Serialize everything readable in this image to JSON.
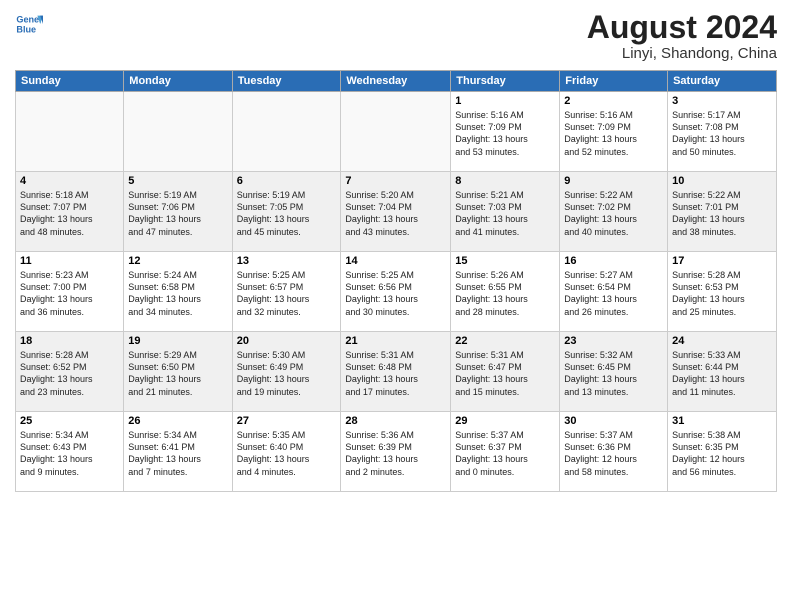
{
  "header": {
    "logo_line1": "General",
    "logo_line2": "Blue",
    "month_title": "August 2024",
    "location": "Linyi, Shandong, China"
  },
  "weekdays": [
    "Sunday",
    "Monday",
    "Tuesday",
    "Wednesday",
    "Thursday",
    "Friday",
    "Saturday"
  ],
  "weeks": [
    [
      {
        "day": "",
        "info": ""
      },
      {
        "day": "",
        "info": ""
      },
      {
        "day": "",
        "info": ""
      },
      {
        "day": "",
        "info": ""
      },
      {
        "day": "1",
        "info": "Sunrise: 5:16 AM\nSunset: 7:09 PM\nDaylight: 13 hours\nand 53 minutes."
      },
      {
        "day": "2",
        "info": "Sunrise: 5:16 AM\nSunset: 7:09 PM\nDaylight: 13 hours\nand 52 minutes."
      },
      {
        "day": "3",
        "info": "Sunrise: 5:17 AM\nSunset: 7:08 PM\nDaylight: 13 hours\nand 50 minutes."
      }
    ],
    [
      {
        "day": "4",
        "info": "Sunrise: 5:18 AM\nSunset: 7:07 PM\nDaylight: 13 hours\nand 48 minutes."
      },
      {
        "day": "5",
        "info": "Sunrise: 5:19 AM\nSunset: 7:06 PM\nDaylight: 13 hours\nand 47 minutes."
      },
      {
        "day": "6",
        "info": "Sunrise: 5:19 AM\nSunset: 7:05 PM\nDaylight: 13 hours\nand 45 minutes."
      },
      {
        "day": "7",
        "info": "Sunrise: 5:20 AM\nSunset: 7:04 PM\nDaylight: 13 hours\nand 43 minutes."
      },
      {
        "day": "8",
        "info": "Sunrise: 5:21 AM\nSunset: 7:03 PM\nDaylight: 13 hours\nand 41 minutes."
      },
      {
        "day": "9",
        "info": "Sunrise: 5:22 AM\nSunset: 7:02 PM\nDaylight: 13 hours\nand 40 minutes."
      },
      {
        "day": "10",
        "info": "Sunrise: 5:22 AM\nSunset: 7:01 PM\nDaylight: 13 hours\nand 38 minutes."
      }
    ],
    [
      {
        "day": "11",
        "info": "Sunrise: 5:23 AM\nSunset: 7:00 PM\nDaylight: 13 hours\nand 36 minutes."
      },
      {
        "day": "12",
        "info": "Sunrise: 5:24 AM\nSunset: 6:58 PM\nDaylight: 13 hours\nand 34 minutes."
      },
      {
        "day": "13",
        "info": "Sunrise: 5:25 AM\nSunset: 6:57 PM\nDaylight: 13 hours\nand 32 minutes."
      },
      {
        "day": "14",
        "info": "Sunrise: 5:25 AM\nSunset: 6:56 PM\nDaylight: 13 hours\nand 30 minutes."
      },
      {
        "day": "15",
        "info": "Sunrise: 5:26 AM\nSunset: 6:55 PM\nDaylight: 13 hours\nand 28 minutes."
      },
      {
        "day": "16",
        "info": "Sunrise: 5:27 AM\nSunset: 6:54 PM\nDaylight: 13 hours\nand 26 minutes."
      },
      {
        "day": "17",
        "info": "Sunrise: 5:28 AM\nSunset: 6:53 PM\nDaylight: 13 hours\nand 25 minutes."
      }
    ],
    [
      {
        "day": "18",
        "info": "Sunrise: 5:28 AM\nSunset: 6:52 PM\nDaylight: 13 hours\nand 23 minutes."
      },
      {
        "day": "19",
        "info": "Sunrise: 5:29 AM\nSunset: 6:50 PM\nDaylight: 13 hours\nand 21 minutes."
      },
      {
        "day": "20",
        "info": "Sunrise: 5:30 AM\nSunset: 6:49 PM\nDaylight: 13 hours\nand 19 minutes."
      },
      {
        "day": "21",
        "info": "Sunrise: 5:31 AM\nSunset: 6:48 PM\nDaylight: 13 hours\nand 17 minutes."
      },
      {
        "day": "22",
        "info": "Sunrise: 5:31 AM\nSunset: 6:47 PM\nDaylight: 13 hours\nand 15 minutes."
      },
      {
        "day": "23",
        "info": "Sunrise: 5:32 AM\nSunset: 6:45 PM\nDaylight: 13 hours\nand 13 minutes."
      },
      {
        "day": "24",
        "info": "Sunrise: 5:33 AM\nSunset: 6:44 PM\nDaylight: 13 hours\nand 11 minutes."
      }
    ],
    [
      {
        "day": "25",
        "info": "Sunrise: 5:34 AM\nSunset: 6:43 PM\nDaylight: 13 hours\nand 9 minutes."
      },
      {
        "day": "26",
        "info": "Sunrise: 5:34 AM\nSunset: 6:41 PM\nDaylight: 13 hours\nand 7 minutes."
      },
      {
        "day": "27",
        "info": "Sunrise: 5:35 AM\nSunset: 6:40 PM\nDaylight: 13 hours\nand 4 minutes."
      },
      {
        "day": "28",
        "info": "Sunrise: 5:36 AM\nSunset: 6:39 PM\nDaylight: 13 hours\nand 2 minutes."
      },
      {
        "day": "29",
        "info": "Sunrise: 5:37 AM\nSunset: 6:37 PM\nDaylight: 13 hours\nand 0 minutes."
      },
      {
        "day": "30",
        "info": "Sunrise: 5:37 AM\nSunset: 6:36 PM\nDaylight: 12 hours\nand 58 minutes."
      },
      {
        "day": "31",
        "info": "Sunrise: 5:38 AM\nSunset: 6:35 PM\nDaylight: 12 hours\nand 56 minutes."
      }
    ]
  ]
}
